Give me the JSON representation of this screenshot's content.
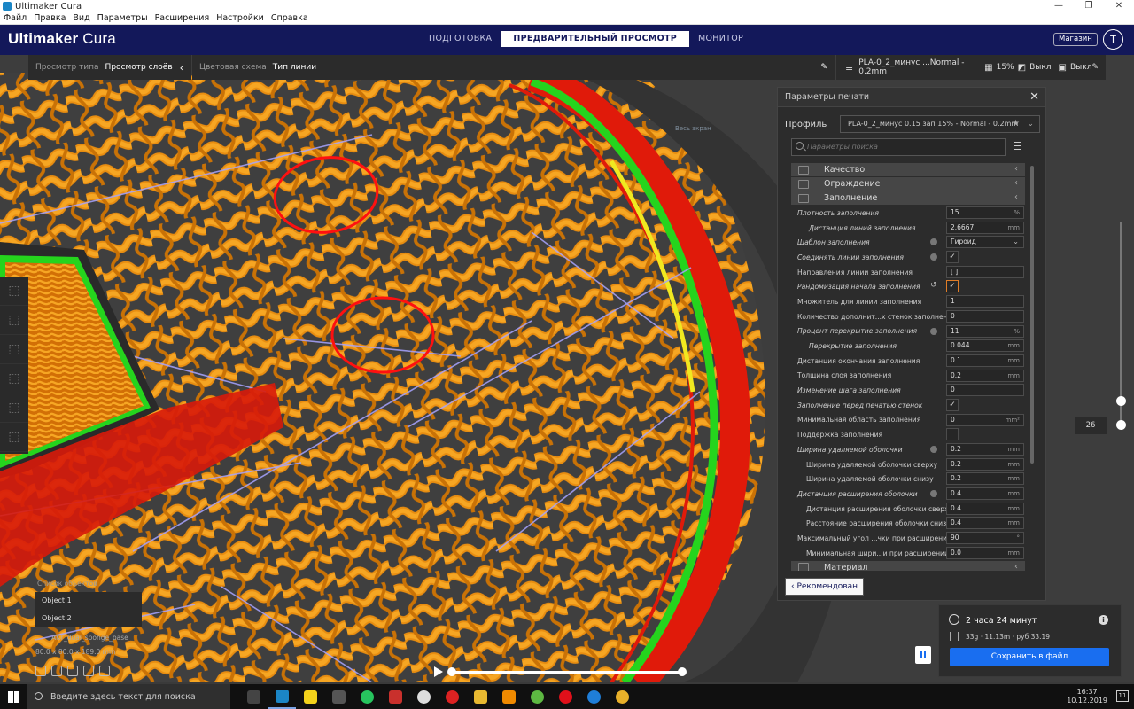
{
  "window": {
    "title": "Ultimaker Cura",
    "minimize": "—",
    "maximize": "❐",
    "close": "✕"
  },
  "menu": [
    "Файл",
    "Правка",
    "Вид",
    "Параметры",
    "Расширения",
    "Настройки",
    "Справка"
  ],
  "header": {
    "logo_brand": "Ultimaker",
    "logo_product": "Cura",
    "stages": [
      {
        "label": "ПОДГОТОВКА",
        "active": false
      },
      {
        "label": "ПРЕДВАРИТЕЛЬНЫЙ ПРОСМОТР",
        "active": true
      },
      {
        "label": "МОНИТОР",
        "active": false
      }
    ],
    "marketplace": "Магазин",
    "account_initial": "T",
    "accent": "#13185a"
  },
  "view_bar": {
    "view_type_label": "Просмотр типа",
    "view_type_value": "Просмотр слоёв",
    "color_scheme_label": "Цветовая схема",
    "color_scheme_value": "Тип линии"
  },
  "summary": {
    "profile": "PLA-0_2_минус ...Normal - 0.2mm",
    "infill": "15%",
    "support": "Выкл",
    "adhesion": "Выкл"
  },
  "settings": {
    "title": "Параметры печати",
    "profile_label": "Профиль",
    "profile_value": "PLA-0_2_минус 0.15 зап 15% - Normal - 0.2mm",
    "search_placeholder": "Параметры поиска",
    "categories": {
      "quality": "Качество",
      "walls": "Ограждение",
      "infill": "Заполнение",
      "material": "Материал"
    },
    "rows": [
      {
        "label": "Плотность заполнения",
        "value": "15",
        "unit": "%"
      },
      {
        "label": "Дистанция линий заполнения",
        "value": "2.6667",
        "unit": "mm"
      },
      {
        "label": "Шаблон заполнения",
        "value": "Гироид"
      },
      {
        "label": "Соединять линии заполнения",
        "value": "✓"
      },
      {
        "label": "Направления линии заполнения",
        "value": "[ ]"
      },
      {
        "label": "Рандомизация начала заполнения",
        "value": "✓"
      },
      {
        "label": "Множитель для линии заполнения",
        "value": "1"
      },
      {
        "label": "Количество дополнит...х стенок заполнения",
        "value": "0"
      },
      {
        "label": "Процент перекрытие заполнения",
        "value": "11",
        "unit": "%"
      },
      {
        "label": "Перекрытие заполнения",
        "value": "0.044",
        "unit": "mm"
      },
      {
        "label": "Дистанция окончания заполнения",
        "value": "0.1",
        "unit": "mm"
      },
      {
        "label": "Толщина слоя заполнения",
        "value": "0.2",
        "unit": "mm"
      },
      {
        "label": "Изменение шага заполнения",
        "value": "0"
      },
      {
        "label": "Заполнение перед печатью стенок",
        "value": "✓"
      },
      {
        "label": "Минимальная область заполнения",
        "value": "0",
        "unit": "mm²"
      },
      {
        "label": "Поддержка заполнения",
        "value": ""
      },
      {
        "label": "Ширина удаляемой оболочки",
        "value": "0.2",
        "unit": "mm"
      },
      {
        "label": "Ширина удаляемой оболочки сверху",
        "value": "0.2",
        "unit": "mm"
      },
      {
        "label": "Ширина удаляемой оболочки снизу",
        "value": "0.2",
        "unit": "mm"
      },
      {
        "label": "Дистанция расширения оболочки",
        "value": "0.4",
        "unit": "mm"
      },
      {
        "label": "Дистанция расширения оболочки сверху",
        "value": "0.4",
        "unit": "mm"
      },
      {
        "label": "Расстояние расширения оболочки снизу",
        "value": "0.4",
        "unit": "mm"
      },
      {
        "label": "Максимальный угол ...чки при расширении",
        "value": "90",
        "unit": "°"
      },
      {
        "label": "Минимальная шири...и при расширении",
        "value": "0.0",
        "unit": "mm"
      }
    ],
    "recommended_button": "Рекомендован"
  },
  "layer": {
    "number": "26"
  },
  "estimate": {
    "time": "2 часа 24 минут",
    "material": "33g · 11.13m · руб 33.19",
    "save_button": "Сохранить в файл",
    "save_color": "#196ef0"
  },
  "objects": {
    "header": "Список объектов",
    "items": [
      "Object 1",
      "Object 2"
    ],
    "file": "AKT_dual_sponge_base",
    "dims": "80.0 x 80.0 x 189.0 mm"
  },
  "taskbar": {
    "search_placeholder": "Введите здесь текст для поиска",
    "time": "16:37",
    "date": "10.12.2019",
    "notifications": "11"
  }
}
